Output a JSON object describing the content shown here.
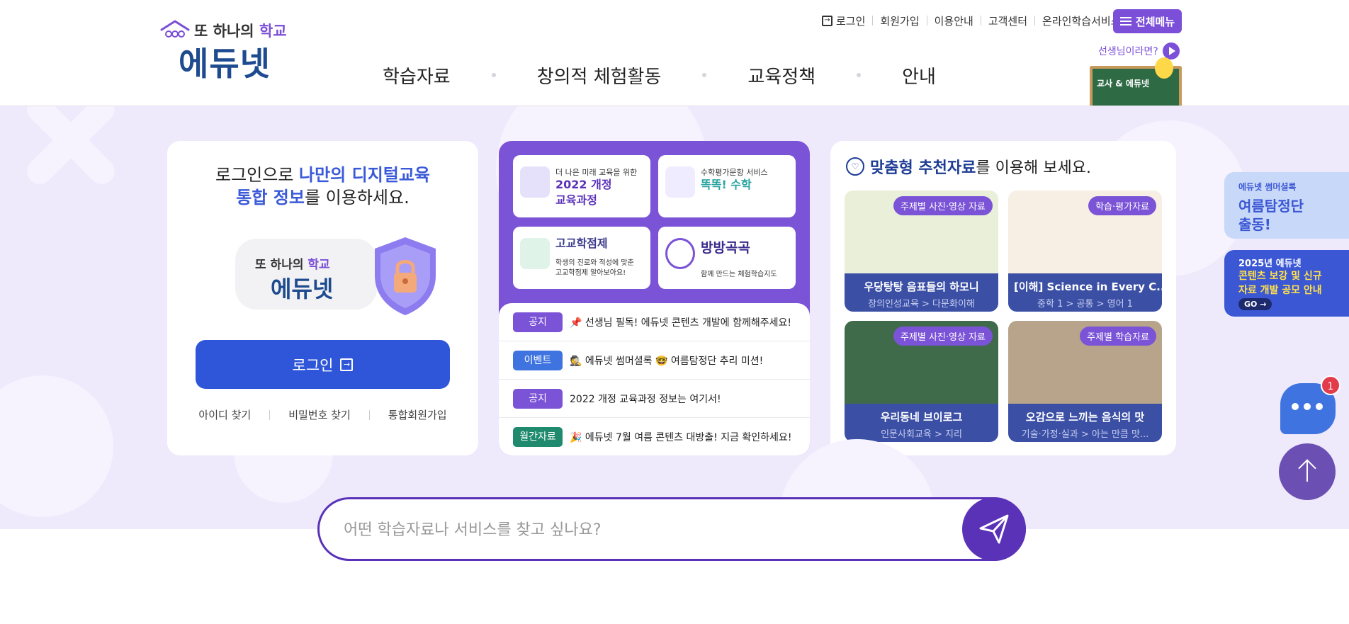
{
  "header": {
    "logo": {
      "sub_pre": "또 하나의 ",
      "sub_accent": "학교",
      "main": "에듀넷"
    },
    "util": [
      "로그인",
      "회원가입",
      "이용안내",
      "고객센터",
      "온라인학습서비스"
    ],
    "all_menu": "전체메뉴",
    "gnb": [
      "학습자료",
      "창의적 체험활동",
      "교육정책",
      "안내"
    ],
    "teacher_link": "선생님이라면?",
    "teacher_board": "교사 & 에듀넷"
  },
  "login_card": {
    "msg_pre": "로그인으로 ",
    "msg_hl1": "나만의 디지털교육",
    "msg_hl2": "통합 정보",
    "msg_post": "를 이용하세요.",
    "badge_sub_pre": "또 하나의 ",
    "badge_sub_accent": "학교",
    "badge_main": "에듀넷",
    "login_button": "로그인",
    "links": [
      "아이디 찾기",
      "비밀번호 찾기",
      "통합회원가입"
    ]
  },
  "tiles": [
    {
      "small": "더 나은 미래 교육을 위한",
      "big": "2022 개정",
      "big2": "교육과정"
    },
    {
      "small": "수학평가문항 서비스",
      "big": "똑똑! 수학",
      "big2": ""
    },
    {
      "small": "",
      "big": "고교학점제",
      "big2": ""
    },
    {
      "small": "",
      "big": "방방곡곡",
      "big2": ""
    }
  ],
  "tile_desc": {
    "t3": [
      "학생의 진로와 적성에 맞춘",
      "고교학점제 알아보아요!"
    ],
    "t4": "함께 만드는 체험학습지도"
  },
  "notices": [
    {
      "tag": "공지",
      "color": "#7b53d6",
      "text": "📌 선생님 필독! 에듀넷 콘텐츠 개발에 함께해주세요!"
    },
    {
      "tag": "이벤트",
      "color": "#3f74e0",
      "text": "🕵 에듀넷 썸머셜록 🤓 여름탐정단 추리 미션!"
    },
    {
      "tag": "공지",
      "color": "#7b53d6",
      "text": "2022 개정 교육과정 정보는 여기서!"
    },
    {
      "tag": "월간자료",
      "color": "#1f8a6e",
      "text": "🎉 에듀넷 7월 여름 콘텐츠 대방출! 지금 확인하세요!"
    }
  ],
  "recommend": {
    "title_hl": "맞춤형 추천자료",
    "title_post": "를 이용해 보세요.",
    "items": [
      {
        "category": "주제별 사진·영상 자료",
        "name": "우당탕탕 음표들의 하모니",
        "path": "창의인성교육 > 다문화이해",
        "thumb": "#e9efd9"
      },
      {
        "category": "학습·평가자료",
        "name": "[이해] Science in Every C...",
        "path": "중학 1 > 공통 > 영어 1",
        "thumb": "#f7efe4"
      },
      {
        "category": "주제별 사진·영상 자료",
        "name": "우리동네 브이로그",
        "path": "인문사회교육 > 지리",
        "thumb": "#3f6b4a"
      },
      {
        "category": "주제별 학습자료",
        "name": "오감으로 느끼는 음식의 맛",
        "path": "기술·가정·실과 > 아는 만큼 맛...",
        "thumb": "#b8a48a"
      }
    ]
  },
  "banners": {
    "b1": [
      "에듀넷 썸머셜록",
      "여름탐정단",
      "출동!"
    ],
    "b2": [
      "2025년 에듀넷",
      "콘텐츠 보강 및 신규",
      "자료 개발 공모 안내"
    ],
    "b2_go": "GO →"
  },
  "chat_badge": "1",
  "search": {
    "placeholder": "어떤 학습자료나 서비스를 찾고 싶나요?"
  }
}
